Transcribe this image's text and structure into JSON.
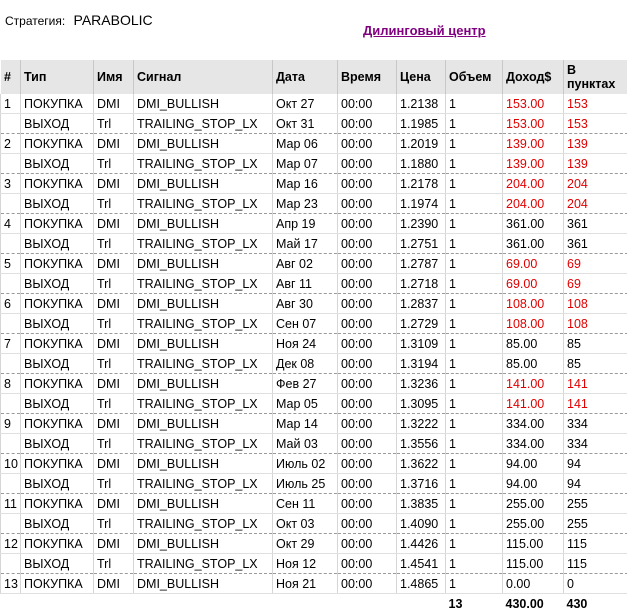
{
  "strategy": {
    "label": "Стратегия:",
    "value": "PARABOLIC"
  },
  "dealing_link": "Дилинговый центр",
  "columns": {
    "num": "#",
    "type": "Тип",
    "name": "Имя",
    "signal": "Сигнал",
    "date": "Дата",
    "time": "Время",
    "price": "Цена",
    "volume": "Объем",
    "income": "Доход$",
    "points": "В пунктах"
  },
  "colors": {
    "loss": "#e00000",
    "link": "#800080",
    "header_bg": "#e6e6e6"
  },
  "trades": [
    {
      "num": "1",
      "buy": {
        "type": "ПОКУПКА",
        "name": "DMI",
        "signal": "DMI_BULLISH",
        "date": "Окт 27",
        "time": "00:00",
        "price": "1.2138",
        "volume": "1",
        "income": "153.00",
        "points": "153"
      },
      "sell": {
        "type": "ВЫХОД",
        "name": "Trl",
        "signal": "TRAILING_STOP_LX",
        "date": "Окт 31",
        "time": "00:00",
        "price": "1.1985",
        "volume": "1",
        "income": "153.00",
        "points": "153"
      },
      "loss": true
    },
    {
      "num": "2",
      "buy": {
        "type": "ПОКУПКА",
        "name": "DMI",
        "signal": "DMI_BULLISH",
        "date": "Мар 06",
        "time": "00:00",
        "price": "1.2019",
        "volume": "1",
        "income": "139.00",
        "points": "139"
      },
      "sell": {
        "type": "ВЫХОД",
        "name": "Trl",
        "signal": "TRAILING_STOP_LX",
        "date": "Мар 07",
        "time": "00:00",
        "price": "1.1880",
        "volume": "1",
        "income": "139.00",
        "points": "139"
      },
      "loss": true
    },
    {
      "num": "3",
      "buy": {
        "type": "ПОКУПКА",
        "name": "DMI",
        "signal": "DMI_BULLISH",
        "date": "Мар 16",
        "time": "00:00",
        "price": "1.2178",
        "volume": "1",
        "income": "204.00",
        "points": "204"
      },
      "sell": {
        "type": "ВЫХОД",
        "name": "Trl",
        "signal": "TRAILING_STOP_LX",
        "date": "Мар 23",
        "time": "00:00",
        "price": "1.1974",
        "volume": "1",
        "income": "204.00",
        "points": "204"
      },
      "loss": true
    },
    {
      "num": "4",
      "buy": {
        "type": "ПОКУПКА",
        "name": "DMI",
        "signal": "DMI_BULLISH",
        "date": "Апр 19",
        "time": "00:00",
        "price": "1.2390",
        "volume": "1",
        "income": "361.00",
        "points": "361"
      },
      "sell": {
        "type": "ВЫХОД",
        "name": "Trl",
        "signal": "TRAILING_STOP_LX",
        "date": "Май 17",
        "time": "00:00",
        "price": "1.2751",
        "volume": "1",
        "income": "361.00",
        "points": "361"
      },
      "loss": false
    },
    {
      "num": "5",
      "buy": {
        "type": "ПОКУПКА",
        "name": "DMI",
        "signal": "DMI_BULLISH",
        "date": "Авг 02",
        "time": "00:00",
        "price": "1.2787",
        "volume": "1",
        "income": "69.00",
        "points": "69"
      },
      "sell": {
        "type": "ВЫХОД",
        "name": "Trl",
        "signal": "TRAILING_STOP_LX",
        "date": "Авг 11",
        "time": "00:00",
        "price": "1.2718",
        "volume": "1",
        "income": "69.00",
        "points": "69"
      },
      "loss": true
    },
    {
      "num": "6",
      "buy": {
        "type": "ПОКУПКА",
        "name": "DMI",
        "signal": "DMI_BULLISH",
        "date": "Авг 30",
        "time": "00:00",
        "price": "1.2837",
        "volume": "1",
        "income": "108.00",
        "points": "108"
      },
      "sell": {
        "type": "ВЫХОД",
        "name": "Trl",
        "signal": "TRAILING_STOP_LX",
        "date": "Сен 07",
        "time": "00:00",
        "price": "1.2729",
        "volume": "1",
        "income": "108.00",
        "points": "108"
      },
      "loss": true
    },
    {
      "num": "7",
      "buy": {
        "type": "ПОКУПКА",
        "name": "DMI",
        "signal": "DMI_BULLISH",
        "date": "Ноя 24",
        "time": "00:00",
        "price": "1.3109",
        "volume": "1",
        "income": "85.00",
        "points": "85"
      },
      "sell": {
        "type": "ВЫХОД",
        "name": "Trl",
        "signal": "TRAILING_STOP_LX",
        "date": "Дек 08",
        "time": "00:00",
        "price": "1.3194",
        "volume": "1",
        "income": "85.00",
        "points": "85"
      },
      "loss": false
    },
    {
      "num": "8",
      "buy": {
        "type": "ПОКУПКА",
        "name": "DMI",
        "signal": "DMI_BULLISH",
        "date": "Фев 27",
        "time": "00:00",
        "price": "1.3236",
        "volume": "1",
        "income": "141.00",
        "points": "141"
      },
      "sell": {
        "type": "ВЫХОД",
        "name": "Trl",
        "signal": "TRAILING_STOP_LX",
        "date": "Мар 05",
        "time": "00:00",
        "price": "1.3095",
        "volume": "1",
        "income": "141.00",
        "points": "141"
      },
      "loss": true
    },
    {
      "num": "9",
      "buy": {
        "type": "ПОКУПКА",
        "name": "DMI",
        "signal": "DMI_BULLISH",
        "date": "Мар 14",
        "time": "00:00",
        "price": "1.3222",
        "volume": "1",
        "income": "334.00",
        "points": "334"
      },
      "sell": {
        "type": "ВЫХОД",
        "name": "Trl",
        "signal": "TRAILING_STOP_LX",
        "date": "Май 03",
        "time": "00:00",
        "price": "1.3556",
        "volume": "1",
        "income": "334.00",
        "points": "334"
      },
      "loss": false
    },
    {
      "num": "10",
      "buy": {
        "type": "ПОКУПКА",
        "name": "DMI",
        "signal": "DMI_BULLISH",
        "date": "Июль 02",
        "time": "00:00",
        "price": "1.3622",
        "volume": "1",
        "income": "94.00",
        "points": "94"
      },
      "sell": {
        "type": "ВЫХОД",
        "name": "Trl",
        "signal": "TRAILING_STOP_LX",
        "date": "Июль 25",
        "time": "00:00",
        "price": "1.3716",
        "volume": "1",
        "income": "94.00",
        "points": "94"
      },
      "loss": false
    },
    {
      "num": "11",
      "buy": {
        "type": "ПОКУПКА",
        "name": "DMI",
        "signal": "DMI_BULLISH",
        "date": "Сен 11",
        "time": "00:00",
        "price": "1.3835",
        "volume": "1",
        "income": "255.00",
        "points": "255"
      },
      "sell": {
        "type": "ВЫХОД",
        "name": "Trl",
        "signal": "TRAILING_STOP_LX",
        "date": "Окт 03",
        "time": "00:00",
        "price": "1.4090",
        "volume": "1",
        "income": "255.00",
        "points": "255"
      },
      "loss": false
    },
    {
      "num": "12",
      "buy": {
        "type": "ПОКУПКА",
        "name": "DMI",
        "signal": "DMI_BULLISH",
        "date": "Окт 29",
        "time": "00:00",
        "price": "1.4426",
        "volume": "1",
        "income": "115.00",
        "points": "115"
      },
      "sell": {
        "type": "ВЫХОД",
        "name": "Trl",
        "signal": "TRAILING_STOP_LX",
        "date": "Ноя 12",
        "time": "00:00",
        "price": "1.4541",
        "volume": "1",
        "income": "115.00",
        "points": "115"
      },
      "loss": false
    }
  ],
  "open_trade": {
    "num": "13",
    "type": "ПОКУПКА",
    "name": "DMI",
    "signal": "DMI_BULLISH",
    "date": "Ноя 21",
    "time": "00:00",
    "price": "1.4865",
    "volume": "1",
    "income": "0.00",
    "points": "0"
  },
  "totals": {
    "volume": "13",
    "income": "430.00",
    "points": "430"
  }
}
